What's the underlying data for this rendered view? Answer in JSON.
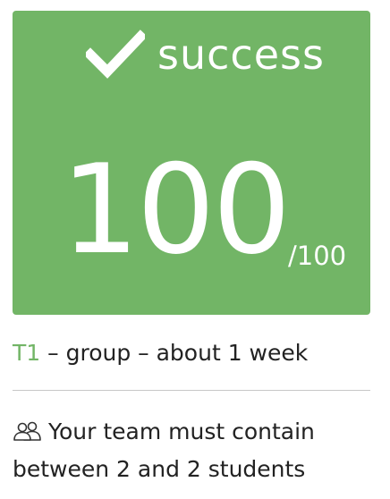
{
  "result": {
    "status_label": "success",
    "score": "100",
    "score_max": "/100",
    "accent_color": "#72b566",
    "status_icon": "check-icon"
  },
  "task": {
    "code": "T1",
    "separator_1": " – ",
    "type": "group",
    "separator_2": " – ",
    "duration": "about 1 week"
  },
  "team": {
    "icon": "users-icon",
    "message": "Your team must contain between 2 and 2 students"
  }
}
